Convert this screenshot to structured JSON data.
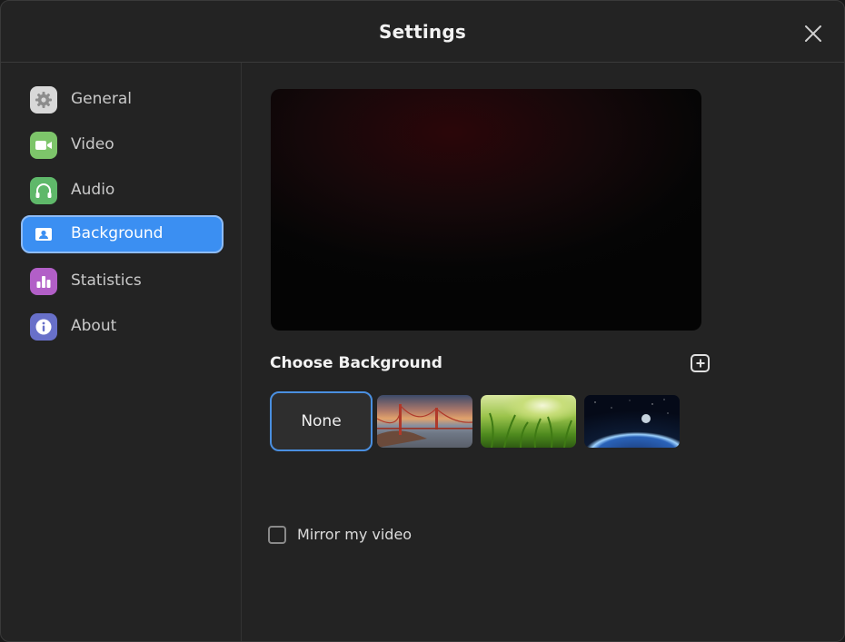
{
  "window": {
    "title": "Settings"
  },
  "sidebar": {
    "items": [
      {
        "label": "General",
        "icon": "gear-icon",
        "color": "#d8d8d8",
        "active": false
      },
      {
        "label": "Video",
        "icon": "video-camera-icon",
        "color": "#7dc56a",
        "active": false
      },
      {
        "label": "Audio",
        "icon": "headphones-icon",
        "color": "#5fb86a",
        "active": false
      },
      {
        "label": "Background",
        "icon": "person-card-icon",
        "color": "#3b8ff2",
        "active": true
      },
      {
        "label": "Statistics",
        "icon": "bar-chart-icon",
        "color": "#b25fc7",
        "active": false
      },
      {
        "label": "About",
        "icon": "info-icon",
        "color": "#6870c9",
        "active": false
      }
    ]
  },
  "main": {
    "choose_background_label": "Choose Background",
    "backgrounds": [
      {
        "label": "None",
        "selected": true
      },
      {
        "label": "",
        "kind": "golden-gate-bridge",
        "selected": false
      },
      {
        "label": "",
        "kind": "grass",
        "selected": false
      },
      {
        "label": "",
        "kind": "earth-from-space",
        "selected": false
      }
    ],
    "mirror_label": "Mirror my video",
    "mirror_checked": false
  },
  "colors": {
    "accent": "#3b8ff2",
    "window_bg": "#232323"
  }
}
